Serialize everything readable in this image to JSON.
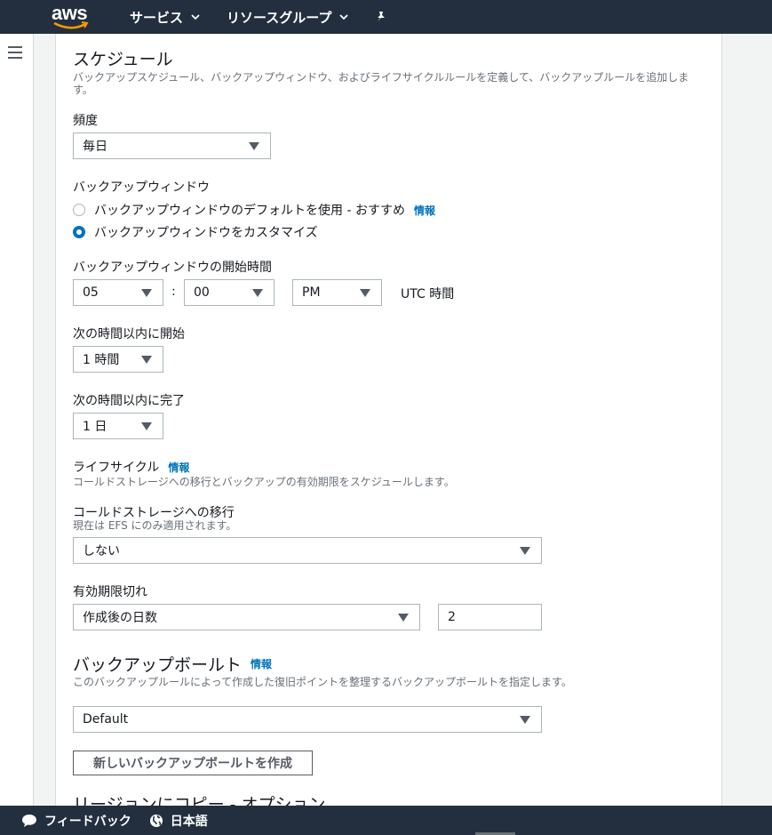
{
  "header": {
    "logo": "aws",
    "services_label": "サービス",
    "resource_groups_label": "リソースグループ"
  },
  "schedule": {
    "title": "スケジュール",
    "description": "バックアップスケジュール、バックアップウィンドウ、およびライフサイクルルールを定義して、バックアップルールを追加しま\nす。",
    "frequency_label": "頻度",
    "frequency_value": "毎日",
    "window_label": "バックアップウィンドウ",
    "window_default_option": "バックアップウィンドウのデフォルトを使用 - おすすめ",
    "window_custom_option": "バックアップウィンドウをカスタマイズ",
    "info_label": "情報",
    "start_time_label": "バックアップウィンドウの開始時間",
    "hour_value": "05",
    "colon": ":",
    "minute_value": "00",
    "ampm_value": "PM",
    "utc_label": "UTC 時間",
    "start_within_label": "次の時間以内に開始",
    "start_within_value": "1 時間",
    "complete_within_label": "次の時間以内に完了",
    "complete_within_value": "1 日"
  },
  "lifecycle": {
    "title": "ライフサイクル",
    "info_label": "情報",
    "description": "コールドストレージへの移行とバックアップの有効期限をスケジュールします。",
    "cold_label": "コールドストレージへの移行",
    "cold_note": "現在は EFS にのみ適用されます。",
    "cold_value": "しない",
    "expire_label": "有効期限切れ",
    "expire_select_value": "作成後の日数",
    "expire_days_value": "2"
  },
  "vault": {
    "title": "バックアップボールト",
    "info_label": "情報",
    "description": "このバックアップルールによって作成した復旧ポイントを整理するバックアップボールトを指定します。",
    "vault_value": "Default",
    "create_button": "新しいバックアップボールトを作成"
  },
  "next_section": {
    "title_partial": "リージョンにコピー - オプション"
  },
  "footer": {
    "feedback_label": "フィードバック",
    "language_label": "日本語"
  },
  "colors": {
    "nav_bg": "#232f3e",
    "accent": "#0073bb",
    "logo_smile": "#ff9900"
  }
}
